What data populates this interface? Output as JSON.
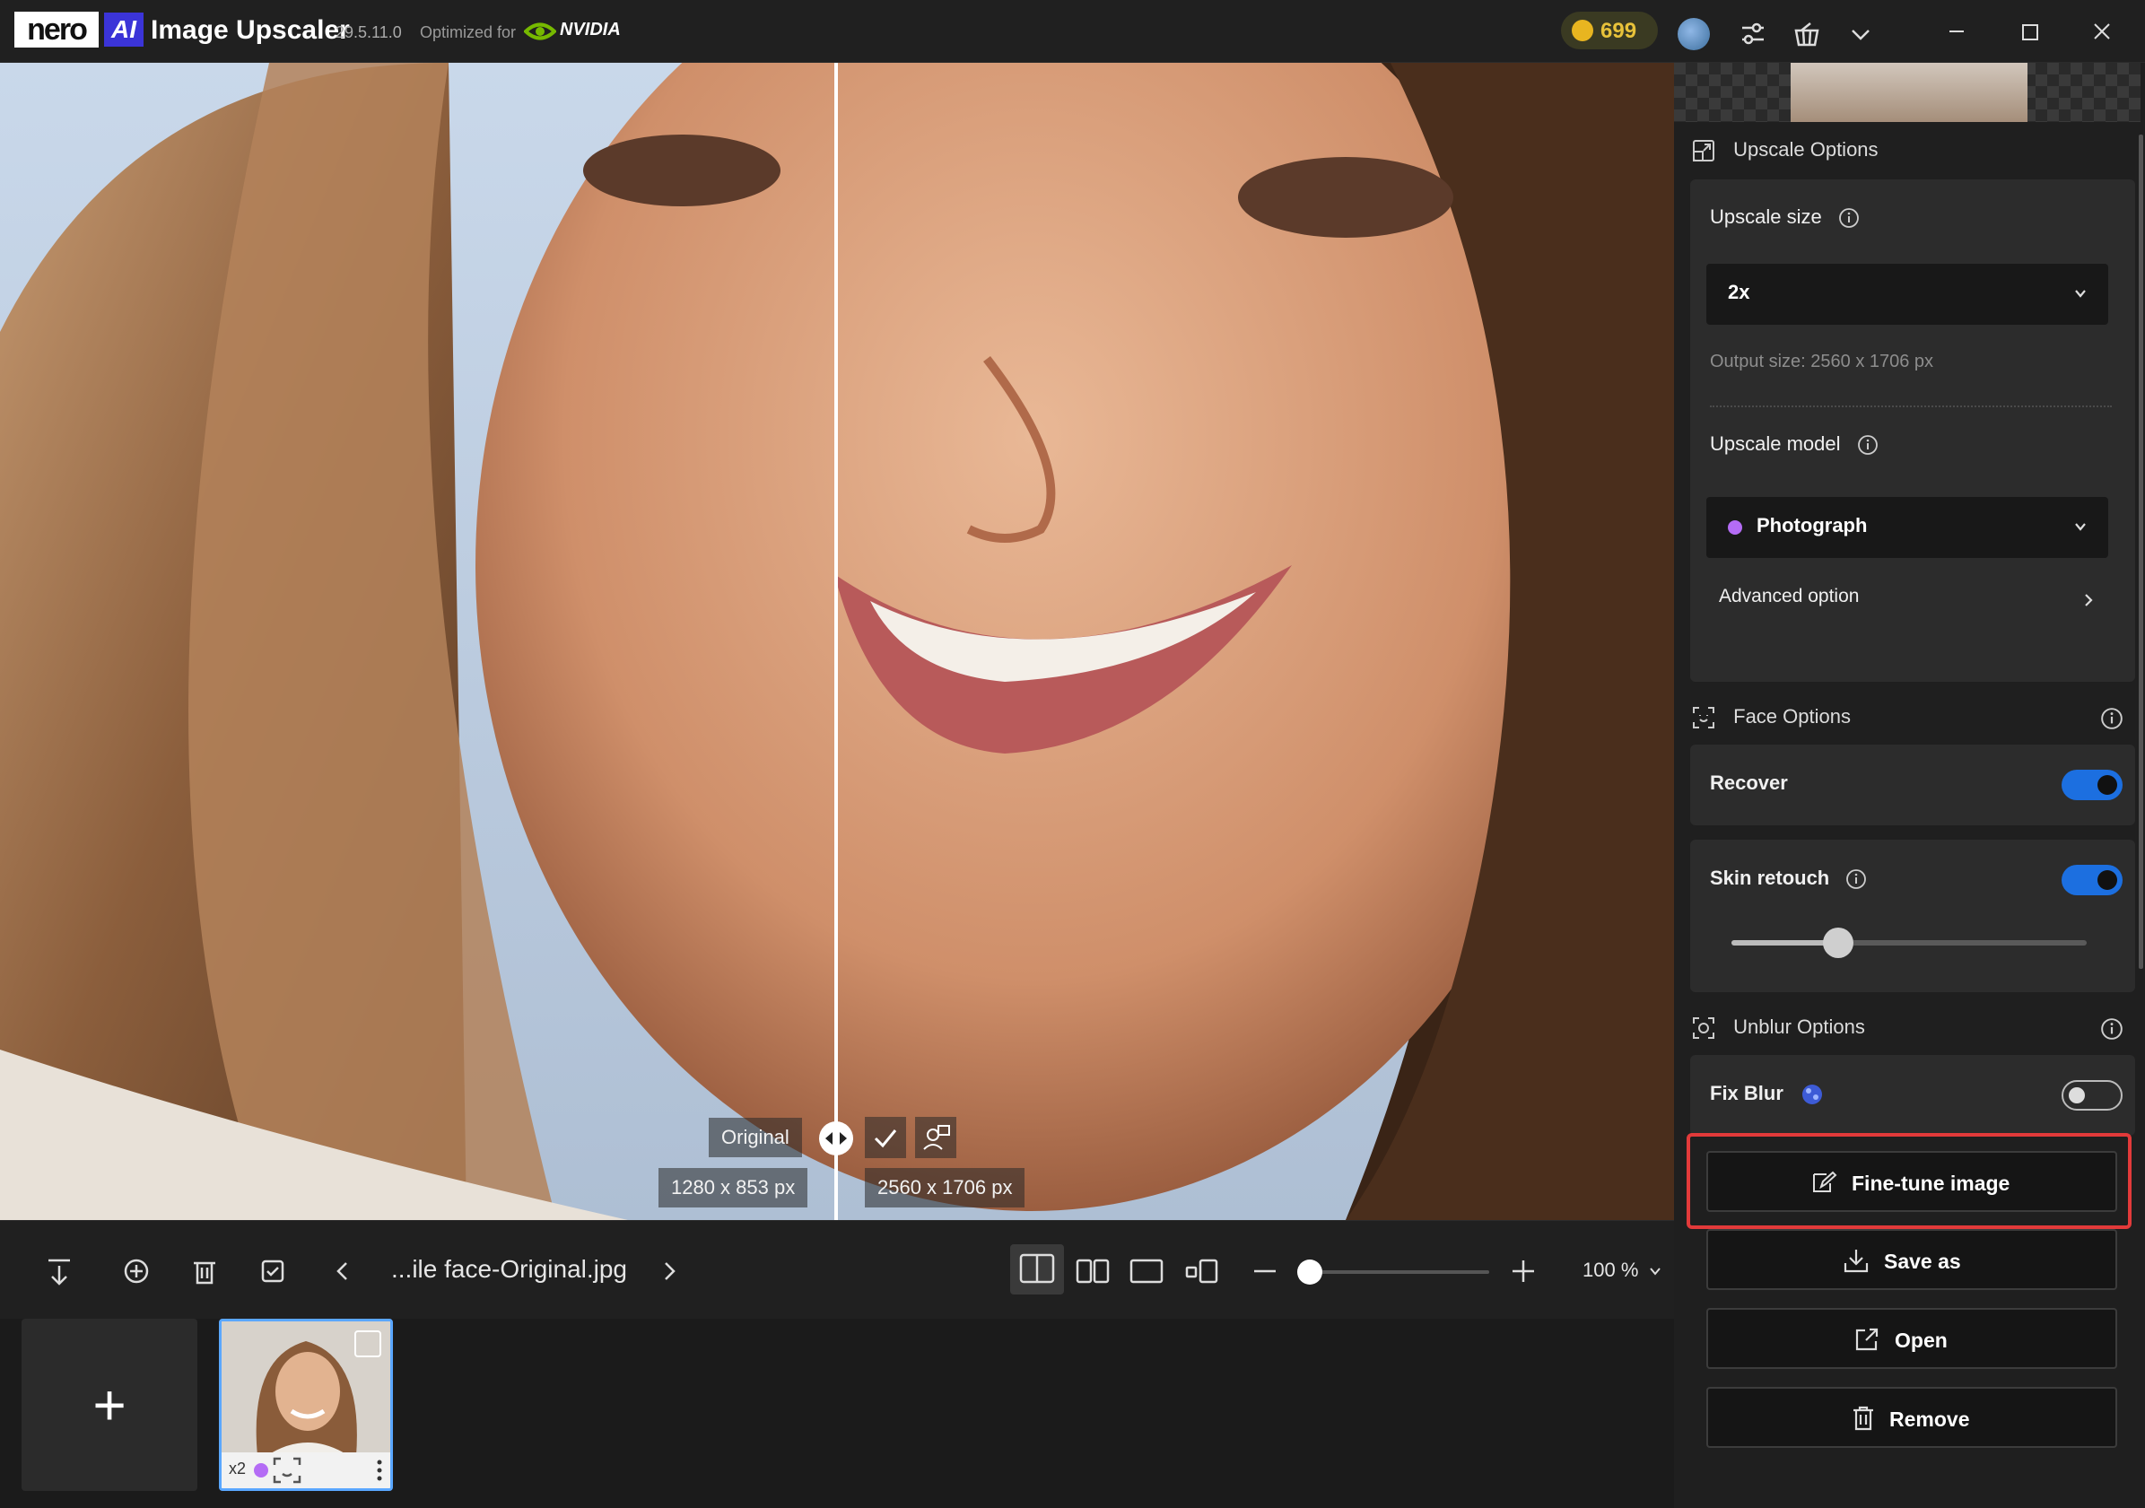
{
  "title_bar": {
    "brand_nero": "nero",
    "brand_ai": "AI",
    "app_name": "Image Upscaler",
    "version": "29.5.11.0",
    "optimized_for": "Optimized for",
    "nvidia": "NVIDIA",
    "credits": "699"
  },
  "canvas": {
    "left_label": "Original",
    "left_size": "1280 x 853 px",
    "right_size": "2560 x 1706 px"
  },
  "toolbar": {
    "filename": "...ile face-Original.jpg",
    "zoom": "100 %"
  },
  "thumbnails": {
    "add_label": "+",
    "item_scale": "x2"
  },
  "sidebar": {
    "upscale_options": {
      "title": "Upscale Options",
      "size_label": "Upscale size",
      "size_value": "2x",
      "output_size": "Output size: 2560 x 1706 px",
      "model_label": "Upscale model",
      "model_value": "Photograph",
      "advanced": "Advanced option"
    },
    "face_options": {
      "title": "Face Options",
      "recover_label": "Recover",
      "recover_on": true,
      "skin_label": "Skin retouch",
      "skin_on": true,
      "skin_level": 0.3
    },
    "unblur_options": {
      "title": "Unblur Options",
      "fixblur_label": "Fix Blur",
      "fixblur_on": false
    },
    "actions": {
      "fine_tune": "Fine-tune image",
      "save_as": "Save as",
      "open": "Open",
      "remove": "Remove"
    }
  },
  "colors": {
    "accent": "#1c6fe0",
    "highlight": "#e23a3a",
    "model_dot": "#b46cf5"
  }
}
